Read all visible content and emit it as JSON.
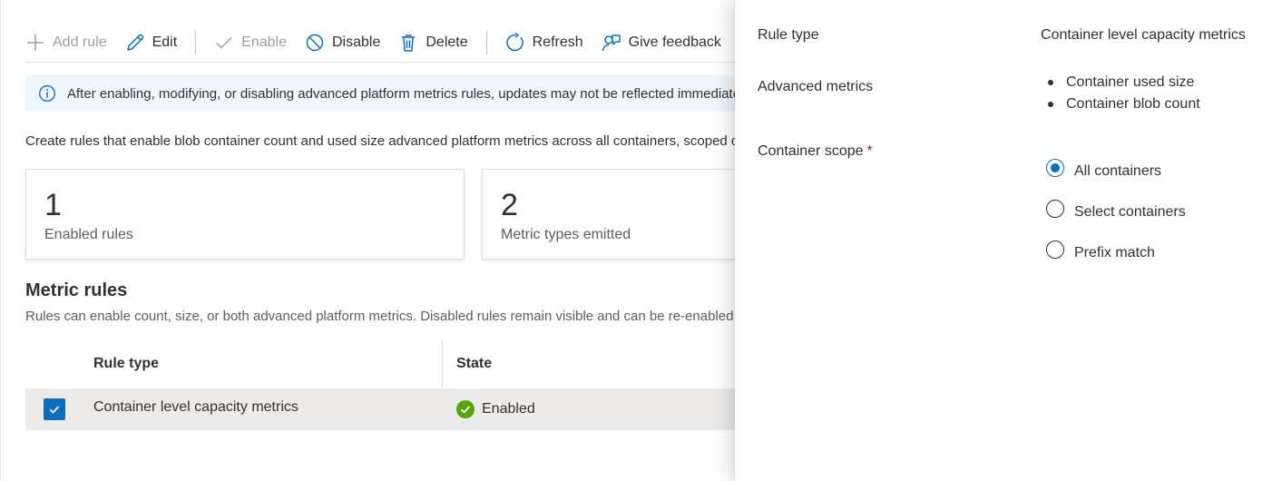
{
  "toolbar": {
    "add_rule": "Add rule",
    "edit": "Edit",
    "enable": "Enable",
    "disable": "Disable",
    "delete": "Delete",
    "refresh": "Refresh",
    "give_feedback": "Give feedback",
    "icons": [
      "plus-icon",
      "pencil-icon",
      "checkmark-icon",
      "block-icon",
      "trash-icon",
      "refresh-icon",
      "feedback-icon"
    ]
  },
  "banner": {
    "icon": "info-icon",
    "text": "After enabling, modifying, or disabling advanced platform metrics rules, updates may not be reflected immediately."
  },
  "description": "Create rules that enable blob container count and used size advanced platform metrics across all containers, scoped containers, or containers matching a prefix.",
  "cards": [
    {
      "value": "1",
      "label": "Enabled rules"
    },
    {
      "value": "2",
      "label": "Metric types emitted"
    }
  ],
  "metric_rules": {
    "title": "Metric rules",
    "description": "Rules can enable count, size, or both advanced platform metrics. Disabled rules remain visible and can be re-enabled at any time.",
    "columns": [
      "Rule type",
      "State"
    ],
    "rows": [
      {
        "rule_type": "Container level capacity metrics",
        "state": "Enabled",
        "selected": true
      }
    ]
  },
  "details": {
    "rule_type_label": "Rule type",
    "rule_type_value": "Container level capacity metrics",
    "advanced_metrics_label": "Advanced metrics",
    "advanced_metrics": [
      "Container used size",
      "Container blob count"
    ],
    "container_scope_label": "Container scope",
    "required_mark": "*",
    "scope_options": [
      "All containers",
      "Select containers",
      "Prefix match"
    ],
    "scope_selected": "All containers"
  },
  "colors": {
    "accent": "#0f6cbd",
    "success": "#57a300",
    "banner_bg": "#eff6fc",
    "selected_row_bg": "#edebe9",
    "required": "#a4262c"
  }
}
